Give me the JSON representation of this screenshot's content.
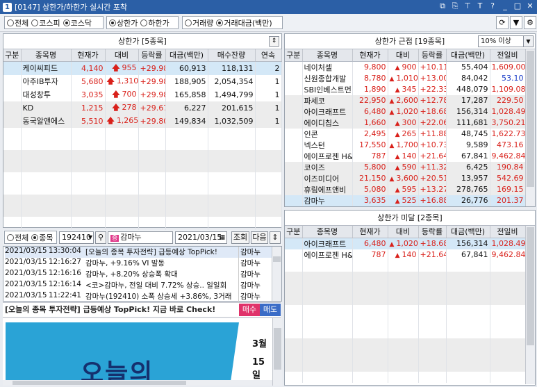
{
  "window": {
    "num": "1",
    "title": "[0147] 상한가/하한가 실시간 포착"
  },
  "toolbar": {
    "market": [
      {
        "label": "전체",
        "on": false
      },
      {
        "label": "코스피",
        "on": false
      },
      {
        "label": "코스닥",
        "on": true
      }
    ],
    "limit": [
      {
        "label": "상한가",
        "on": true
      },
      {
        "label": "하한가",
        "on": false
      }
    ],
    "volume": [
      {
        "label": "거래량",
        "on": false
      },
      {
        "label": "거래대금(백만)",
        "on": true
      }
    ]
  },
  "upper": {
    "title": "상한가 [5종목]",
    "headers": [
      "구분",
      "종목명",
      "현재가",
      "대비",
      "등락률",
      "대금(백만)",
      "매수잔량",
      "연속"
    ],
    "rows": [
      {
        "name": "케이씨피드",
        "price": "4,140",
        "diff": "955",
        "rate": "+29.98",
        "amount": "60,913",
        "bid": "118,131",
        "cont": "2"
      },
      {
        "name": "아주IB투자",
        "price": "5,680",
        "diff": "1,310",
        "rate": "+29.98",
        "amount": "188,905",
        "bid": "2,054,354",
        "cont": "1"
      },
      {
        "name": "대성창투",
        "price": "3,035",
        "diff": "700",
        "rate": "+29.98",
        "amount": "165,858",
        "bid": "1,494,799",
        "cont": "1"
      },
      {
        "name": "KD",
        "price": "1,215",
        "diff": "278",
        "rate": "+29.67",
        "amount": "6,227",
        "bid": "201,615",
        "cont": "1"
      },
      {
        "name": "동국알앤에스",
        "price": "5,510",
        "diff": "1,265",
        "rate": "+29.80",
        "amount": "149,834",
        "bid": "1,032,509",
        "cont": "1"
      }
    ]
  },
  "near": {
    "title": "상한가 근접 [19종목]",
    "filter": "10% 이상",
    "headers": [
      "구분",
      "종목명",
      "현재가",
      "대비",
      "등락률",
      "대금(백만)",
      "전일비"
    ],
    "rows": [
      {
        "name": "네이처셀",
        "price": "9,800",
        "diff": "900",
        "rate": "+10.11",
        "amount": "55,404",
        "prev": "1,609.00",
        "pc": "red"
      },
      {
        "name": "신원종합개발",
        "price": "8,780",
        "diff": "1,010",
        "rate": "+13.00",
        "amount": "84,042",
        "prev": "53.10",
        "pc": "blue"
      },
      {
        "name": "SBI인베스트먼",
        "price": "1,890",
        "diff": "345",
        "rate": "+22.33",
        "amount": "448,079",
        "prev": "1,109.08",
        "pc": "red"
      },
      {
        "name": "파세코",
        "price": "22,950",
        "diff": "2,600",
        "rate": "+12.78",
        "amount": "17,287",
        "prev": "229.50",
        "pc": "red"
      },
      {
        "name": "아이크래프트",
        "price": "6,480",
        "diff": "1,020",
        "rate": "+18.68",
        "amount": "156,314",
        "prev": "1,028.49",
        "pc": "red"
      },
      {
        "name": "에이디칩스",
        "price": "1,660",
        "diff": "300",
        "rate": "+22.06",
        "amount": "111,681",
        "prev": "3,750.21",
        "pc": "red"
      },
      {
        "name": "인콘",
        "price": "2,495",
        "diff": "265",
        "rate": "+11.88",
        "amount": "48,745",
        "prev": "1,622.73",
        "pc": "red"
      },
      {
        "name": "넥스턴",
        "price": "17,550",
        "diff": "1,700",
        "rate": "+10.73",
        "amount": "9,589",
        "prev": "473.16",
        "pc": "red"
      },
      {
        "name": "에이프로젠 H&",
        "price": "787",
        "diff": "140",
        "rate": "+21.64",
        "amount": "67,841",
        "prev": "9,462.84",
        "pc": "red"
      },
      {
        "name": "코이즈",
        "price": "5,800",
        "diff": "590",
        "rate": "+11.32",
        "amount": "6,425",
        "prev": "190.84",
        "pc": "red"
      },
      {
        "name": "이즈미디어",
        "price": "21,150",
        "diff": "3,600",
        "rate": "+20.51",
        "amount": "13,957",
        "prev": "542.69",
        "pc": "red"
      },
      {
        "name": "휴림에프앤비",
        "price": "5,080",
        "diff": "595",
        "rate": "+13.27",
        "amount": "278,765",
        "prev": "169.15",
        "pc": "red"
      },
      {
        "name": "감마누",
        "price": "3,635",
        "diff": "525",
        "rate": "+16.88",
        "amount": "26,776",
        "prev": "201.37",
        "pc": "red"
      }
    ]
  },
  "below": {
    "title": "상한가 미달 [2종목]",
    "headers": [
      "구분",
      "종목명",
      "현재가",
      "대비",
      "등락률",
      "대금(백만)",
      "전일비"
    ],
    "rows": [
      {
        "name": "아이크래프트",
        "price": "6,480",
        "diff": "1,020",
        "rate": "+18.68",
        "amount": "156,314",
        "prev": "1,028.49"
      },
      {
        "name": "에이프로젠 H&",
        "price": "787",
        "diff": "140",
        "rate": "+21.64",
        "amount": "67,841",
        "prev": "9,462.84"
      }
    ]
  },
  "news": {
    "scope": [
      {
        "label": "전체",
        "on": false
      },
      {
        "label": "종목",
        "on": true
      }
    ],
    "code": "192410",
    "stock_tag": "증",
    "stock_name": "감마누",
    "date": "2021/03/15",
    "search_label": "조회",
    "next_label": "다음",
    "items": [
      {
        "date": "2021/03/15",
        "time": "13:30:04",
        "text": "[오늘의 종목 투자전략] 급등예상 TopPick!",
        "stock": "감마누"
      },
      {
        "date": "2021/03/15",
        "time": "12:16:27",
        "text": "감마누, +9.16% VI 발동",
        "stock": "감마누"
      },
      {
        "date": "2021/03/15",
        "time": "12:16:16",
        "text": "감마누, +8.20% 상승폭 확대",
        "stock": "감마누"
      },
      {
        "date": "2021/03/15",
        "time": "12:16:14",
        "text": "<코>감마누, 전일 대비 7.72% 상승.. 일일회",
        "stock": "감마누"
      },
      {
        "date": "2021/03/15",
        "time": "11:22:41",
        "text": "감마누(192410)  소폭 상승세 +3.86%, 3거래",
        "stock": "감마누"
      }
    ],
    "banner": "[오늘의 종목 투자전략] 급등예상 TopPick! 지금 바로 Check!",
    "buy": "매수",
    "sell": "매도",
    "ad_month": "3월",
    "ad_day": "15일",
    "ad_big": "오늘의"
  }
}
